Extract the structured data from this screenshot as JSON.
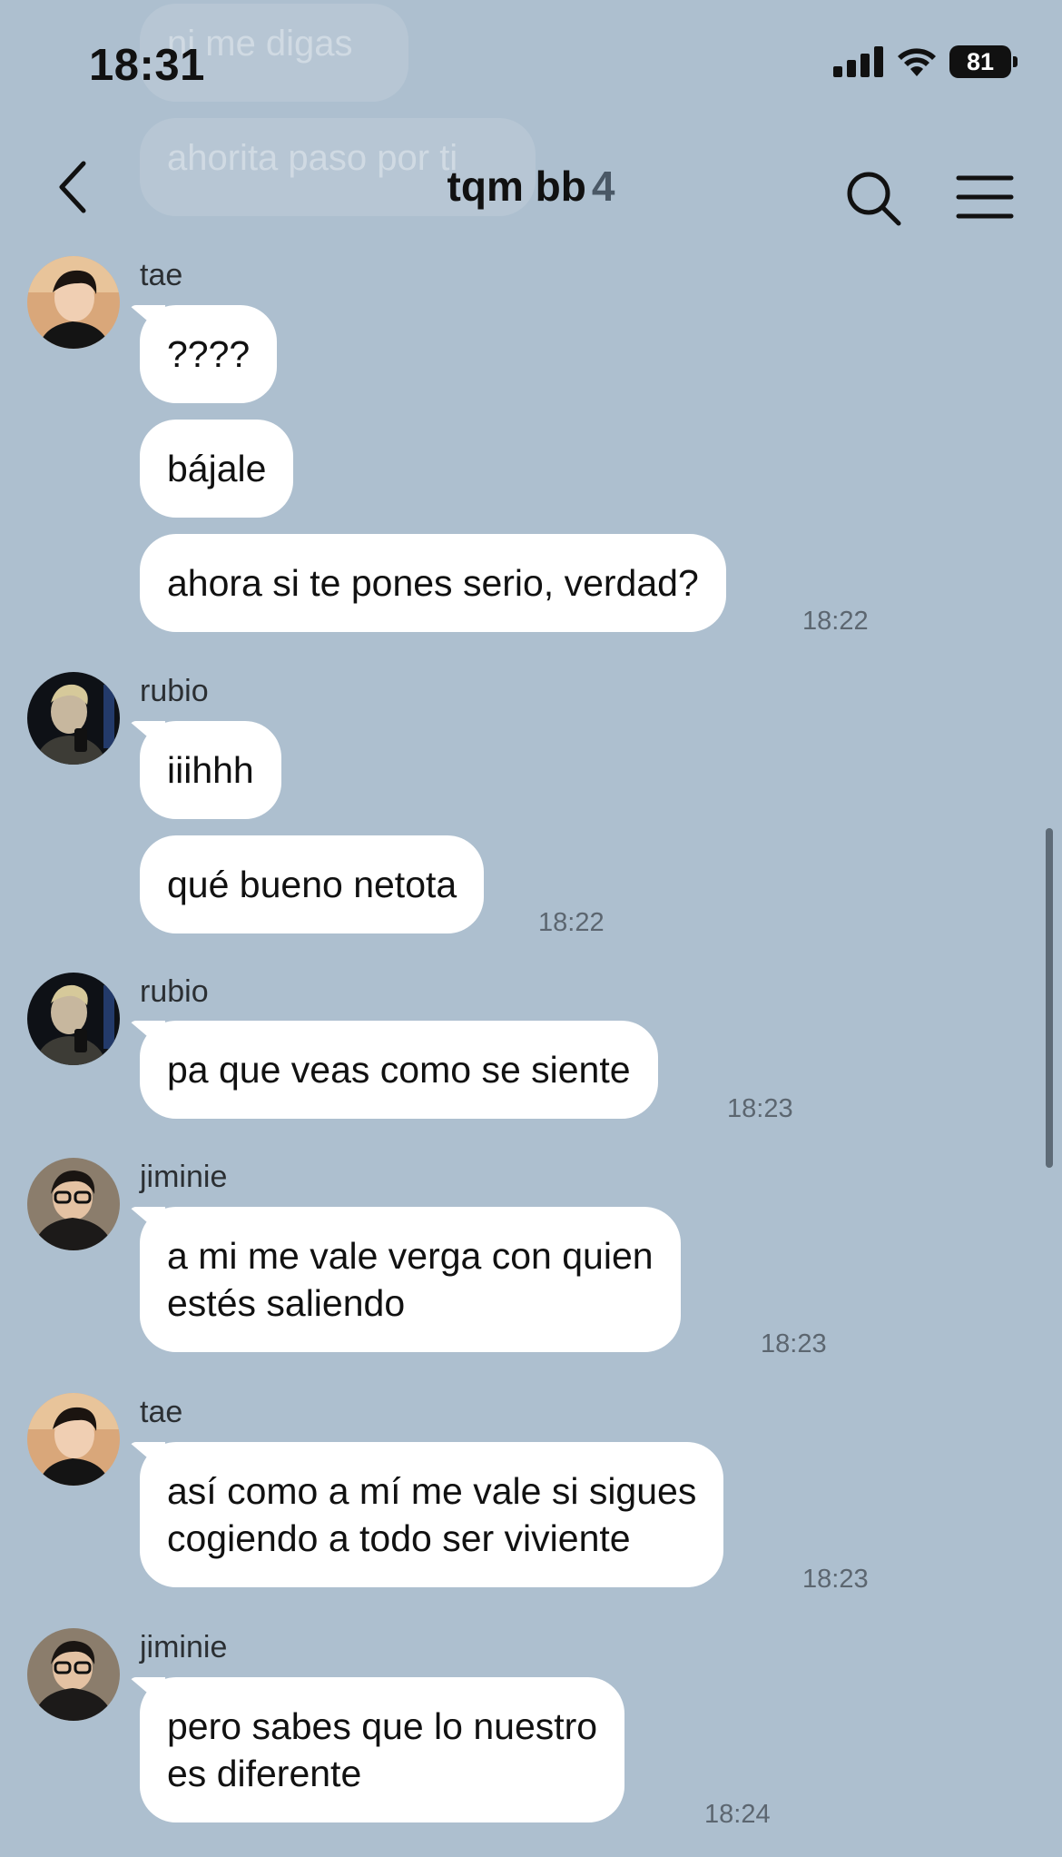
{
  "status_bar": {
    "time": "18:31",
    "battery": "81"
  },
  "ghost_messages": [
    "ni me digas",
    "ahorita paso por ti"
  ],
  "header": {
    "title": "tqm bb",
    "member_count": "4"
  },
  "messages": [
    {
      "sender": "tae",
      "bubbles": [
        "????",
        "bájale",
        "ahora si te pones serio, verdad?"
      ],
      "time": "18:22"
    },
    {
      "sender": "rubio",
      "bubbles": [
        "iiihhh",
        "qué bueno netota"
      ],
      "time": "18:22"
    },
    {
      "sender": "rubio",
      "bubbles": [
        "pa que veas como se siente"
      ],
      "time": "18:23"
    },
    {
      "sender": "jiminie",
      "bubbles": [
        "a mi me vale verga con quien\nestés saliendo"
      ],
      "time": "18:23"
    },
    {
      "sender": "tae",
      "bubbles": [
        "así como a mí me vale si sigues\ncogiendo a todo ser viviente"
      ],
      "time": "18:23"
    },
    {
      "sender": "jiminie",
      "bubbles": [
        "pero sabes que lo nuestro\nes diferente"
      ],
      "time": "18:24"
    }
  ],
  "icons": {
    "back": "chevron-left-icon",
    "search": "search-icon",
    "menu": "hamburger-menu-icon",
    "signal": "cellular-signal-icon",
    "wifi": "wifi-icon",
    "battery": "battery-icon"
  }
}
